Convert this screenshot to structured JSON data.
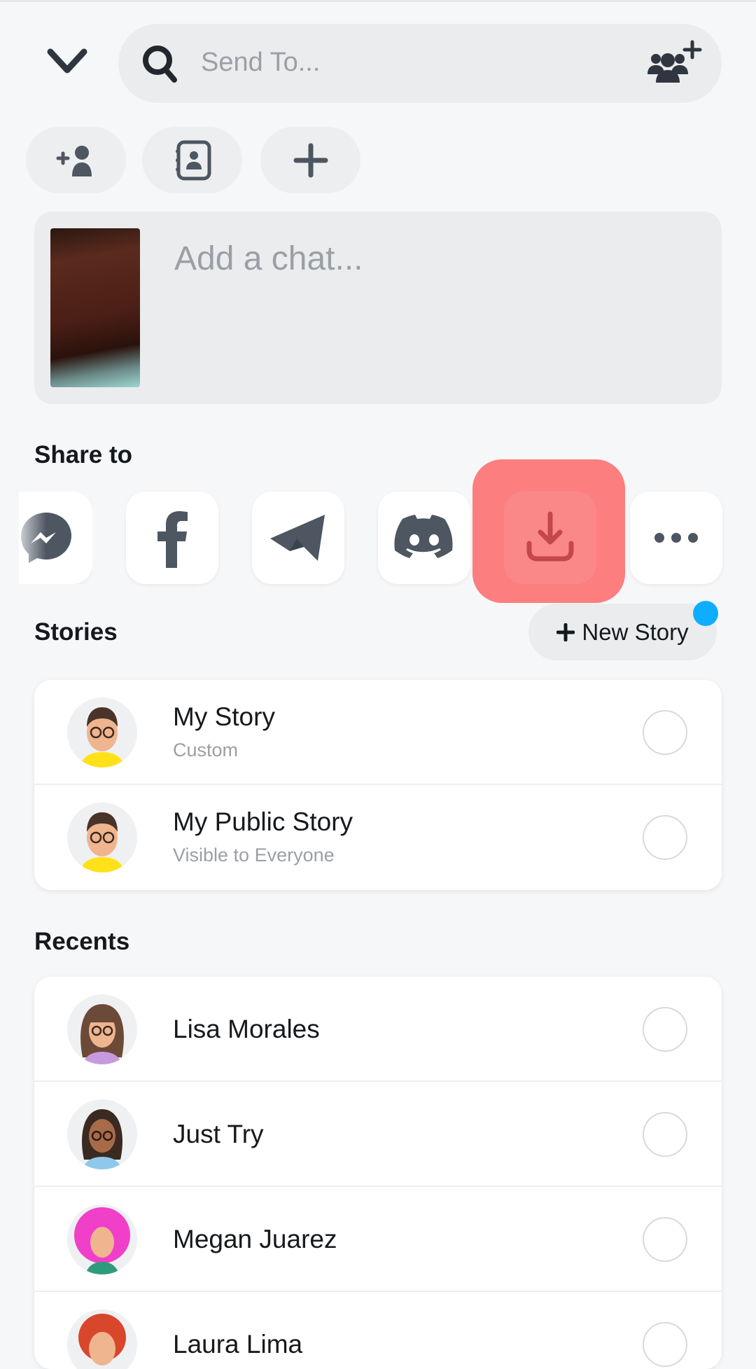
{
  "header": {
    "search_placeholder": "Send To...",
    "icons": [
      "chevron-down-icon",
      "search-icon",
      "new-group-icon"
    ]
  },
  "quick_actions": [
    {
      "name": "add-friend",
      "icon": "add-friend-icon"
    },
    {
      "name": "contacts",
      "icon": "contacts-icon"
    },
    {
      "name": "create",
      "icon": "plus-icon"
    }
  ],
  "chat": {
    "placeholder": "Add a chat..."
  },
  "share": {
    "title": "Share to",
    "targets": [
      "Messenger",
      "Facebook",
      "Telegram",
      "Discord",
      "Download",
      "More"
    ],
    "highlight_color": "#fc7e7f"
  },
  "stories": {
    "title": "Stories",
    "new_story_label": "New Story",
    "items": [
      {
        "name": "My Story",
        "subtitle": "Custom"
      },
      {
        "name": "My Public Story",
        "subtitle": "Visible to Everyone"
      }
    ]
  },
  "recents": {
    "title": "Recents",
    "items": [
      {
        "name": "Lisa Morales"
      },
      {
        "name": "Just Try"
      },
      {
        "name": "Megan Juarez"
      },
      {
        "name": "Laura Lima"
      }
    ]
  },
  "colors": {
    "accent_dot": "#0fadff",
    "icon": "#4d5661"
  }
}
